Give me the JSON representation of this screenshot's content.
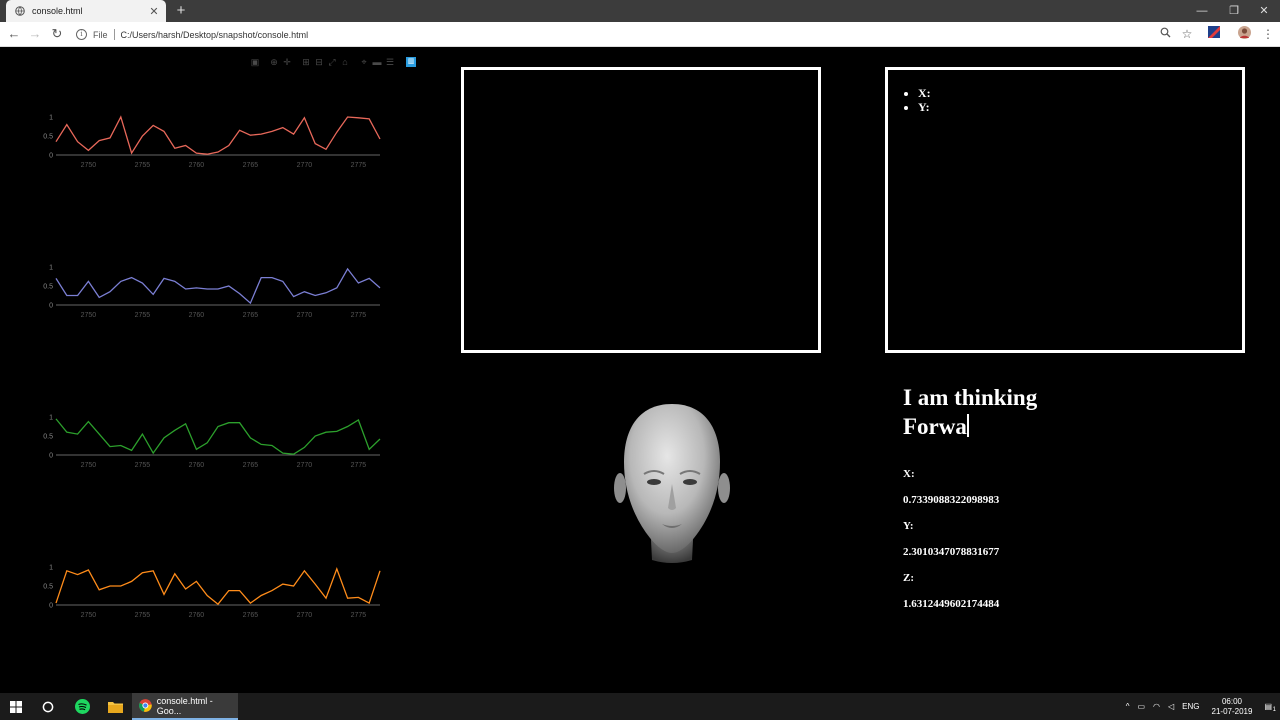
{
  "browser": {
    "tab_title": "console.html",
    "new_tab_label": "+",
    "url_scheme_label": "File",
    "url": "C:/Users/harsh/Desktop/snapshot/console.html"
  },
  "charts": [
    {
      "color": "#e8685a",
      "y_ticks": [
        "0",
        "0.5",
        "1"
      ],
      "x_ticks": [
        "2750",
        "2755",
        "2760",
        "2765",
        "2770",
        "2775"
      ],
      "chart_data": {
        "type": "line",
        "x": [
          2747,
          2748,
          2749,
          2750,
          2751,
          2752,
          2753,
          2754,
          2755,
          2756,
          2757,
          2758,
          2759,
          2760,
          2761,
          2762,
          2763,
          2764,
          2765,
          2766,
          2767,
          2768,
          2769,
          2770,
          2771,
          2772,
          2773,
          2774,
          2775,
          2776,
          2777
        ],
        "y": [
          0.35,
          0.8,
          0.35,
          0.12,
          0.38,
          0.45,
          1.0,
          0.05,
          0.5,
          0.78,
          0.62,
          0.18,
          0.25,
          0.05,
          0.02,
          0.08,
          0.25,
          0.65,
          0.52,
          0.55,
          0.62,
          0.72,
          0.55,
          0.98,
          0.3,
          0.15,
          0.6,
          1.0,
          0.98,
          0.95,
          0.42
        ],
        "ylim": [
          0,
          1
        ],
        "xlim": [
          2747,
          2777
        ]
      }
    },
    {
      "color": "#7b7fd4",
      "y_ticks": [
        "0",
        "0.5",
        "1"
      ],
      "x_ticks": [
        "2750",
        "2755",
        "2760",
        "2765",
        "2770",
        "2775"
      ],
      "chart_data": {
        "type": "line",
        "x": [
          2747,
          2748,
          2749,
          2750,
          2751,
          2752,
          2753,
          2754,
          2755,
          2756,
          2757,
          2758,
          2759,
          2760,
          2761,
          2762,
          2763,
          2764,
          2765,
          2766,
          2767,
          2768,
          2769,
          2770,
          2771,
          2772,
          2773,
          2774,
          2775,
          2776,
          2777
        ],
        "y": [
          0.7,
          0.25,
          0.25,
          0.62,
          0.2,
          0.35,
          0.62,
          0.72,
          0.58,
          0.28,
          0.7,
          0.62,
          0.42,
          0.45,
          0.42,
          0.42,
          0.5,
          0.3,
          0.05,
          0.72,
          0.72,
          0.62,
          0.22,
          0.35,
          0.25,
          0.32,
          0.45,
          0.95,
          0.58,
          0.7,
          0.45
        ],
        "ylim": [
          0,
          1
        ],
        "xlim": [
          2747,
          2777
        ]
      }
    },
    {
      "color": "#2ca02c",
      "y_ticks": [
        "0",
        "0.5",
        "1"
      ],
      "x_ticks": [
        "2750",
        "2755",
        "2760",
        "2765",
        "2770",
        "2775"
      ],
      "chart_data": {
        "type": "line",
        "x": [
          2747,
          2748,
          2749,
          2750,
          2751,
          2752,
          2753,
          2754,
          2755,
          2756,
          2757,
          2758,
          2759,
          2760,
          2761,
          2762,
          2763,
          2764,
          2765,
          2766,
          2767,
          2768,
          2769,
          2770,
          2771,
          2772,
          2773,
          2774,
          2775,
          2776,
          2777
        ],
        "y": [
          0.95,
          0.6,
          0.55,
          0.88,
          0.55,
          0.22,
          0.25,
          0.12,
          0.55,
          0.05,
          0.45,
          0.65,
          0.82,
          0.15,
          0.32,
          0.75,
          0.85,
          0.85,
          0.45,
          0.28,
          0.25,
          0.05,
          0.02,
          0.2,
          0.5,
          0.6,
          0.62,
          0.75,
          0.92,
          0.15,
          0.42
        ],
        "ylim": [
          0,
          1
        ],
        "xlim": [
          2747,
          2777
        ]
      }
    },
    {
      "color": "#ff8c1a",
      "y_ticks": [
        "0",
        "0.5",
        "1"
      ],
      "x_ticks": [
        "2750",
        "2755",
        "2760",
        "2765",
        "2770",
        "2775"
      ],
      "chart_data": {
        "type": "line",
        "x": [
          2747,
          2748,
          2749,
          2750,
          2751,
          2752,
          2753,
          2754,
          2755,
          2756,
          2757,
          2758,
          2759,
          2760,
          2761,
          2762,
          2763,
          2764,
          2765,
          2766,
          2767,
          2768,
          2769,
          2770,
          2771,
          2772,
          2773,
          2774,
          2775,
          2776,
          2777
        ],
        "y": [
          0.05,
          0.9,
          0.8,
          0.92,
          0.4,
          0.5,
          0.5,
          0.62,
          0.85,
          0.9,
          0.28,
          0.82,
          0.42,
          0.62,
          0.25,
          0.02,
          0.38,
          0.38,
          0.05,
          0.25,
          0.38,
          0.55,
          0.5,
          0.9,
          0.55,
          0.18,
          0.95,
          0.18,
          0.2,
          0.05,
          0.9
        ],
        "ylim": [
          0,
          1
        ],
        "xlim": [
          2747,
          2777
        ]
      }
    }
  ],
  "coordinate_panel": {
    "items": [
      "X:",
      "Y:"
    ]
  },
  "thinking": {
    "line1": "I am thinking",
    "line2": "Forwa"
  },
  "readout": {
    "x_label": "X:",
    "x_value": "0.7339088322098983",
    "y_label": "Y:",
    "y_value": "2.3010347078831677",
    "z_label": "Z:",
    "z_value": "1.6312449602174484"
  },
  "taskbar": {
    "chrome_label": "console.html - Goo...",
    "language": "ENG",
    "time": "06:00",
    "date": "21-07-2019",
    "notification_count": "1"
  }
}
